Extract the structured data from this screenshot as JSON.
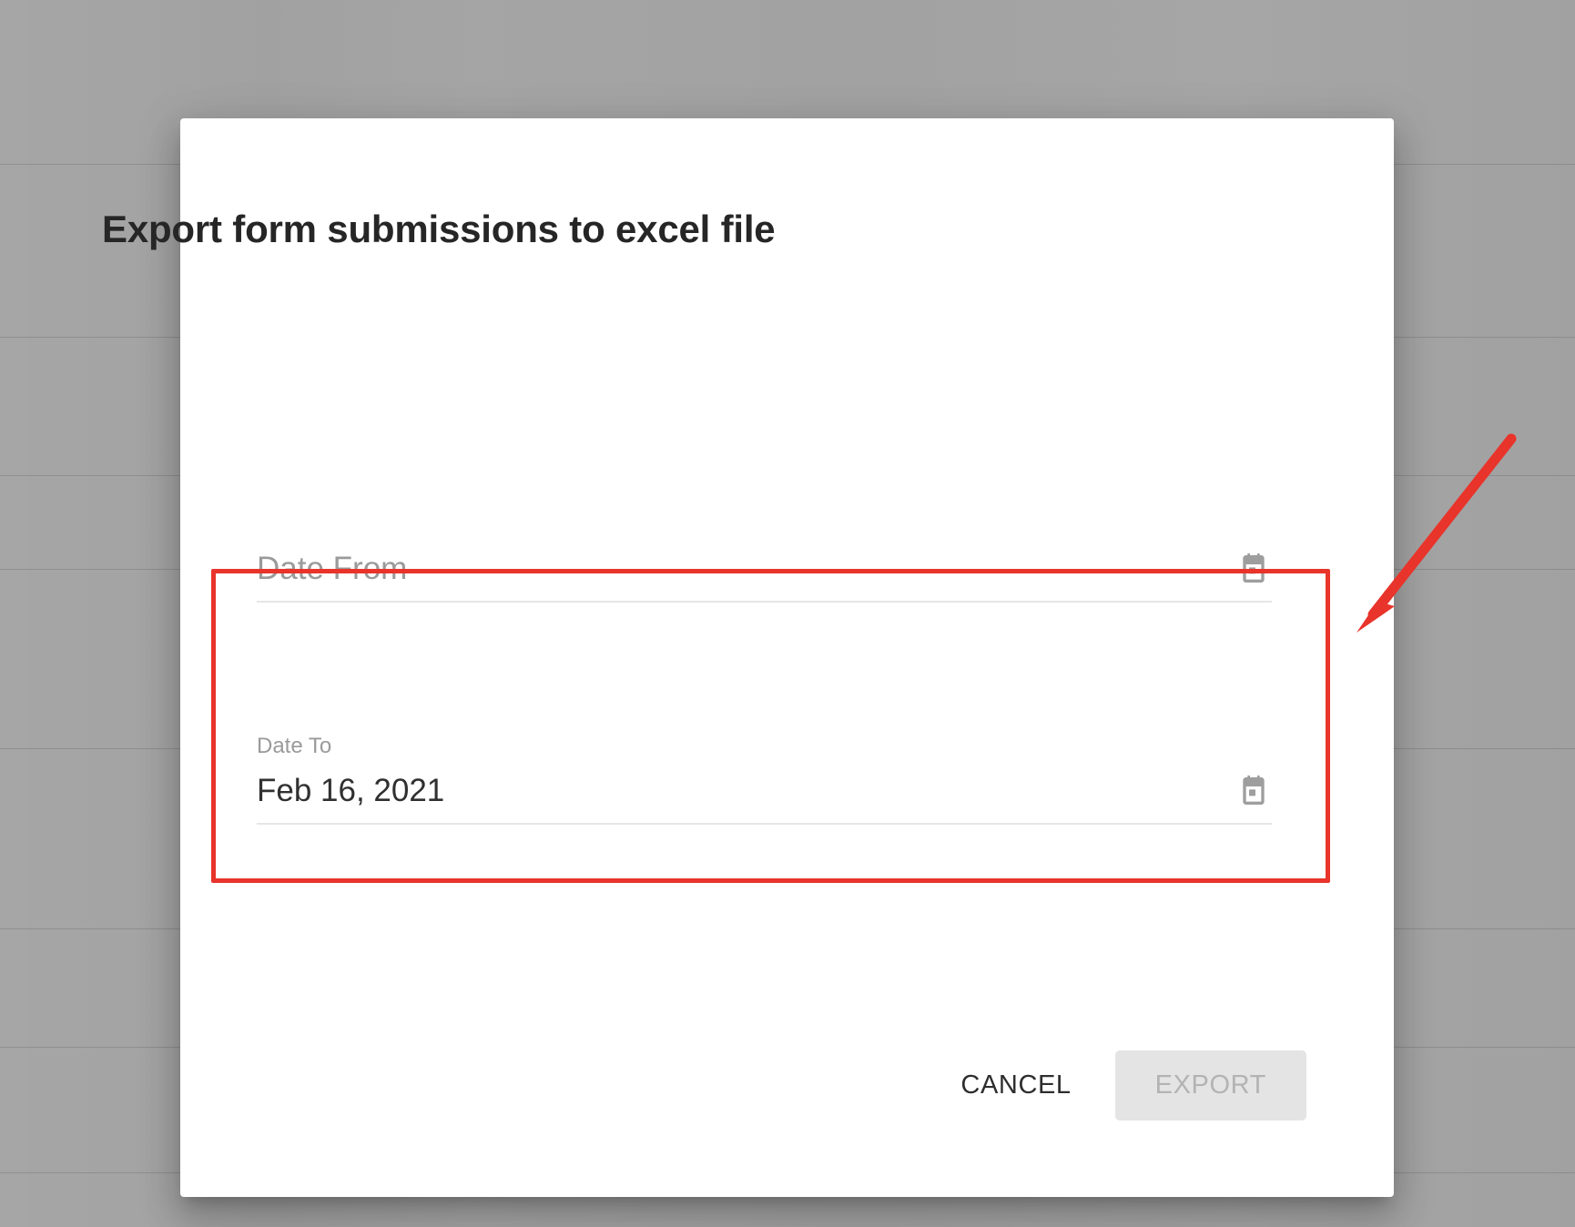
{
  "backdrop": {
    "scrim_color": "#a3a3a3",
    "row_line_color": "#d0d0d0",
    "row_line_positions": [
      180,
      370,
      522,
      625,
      822,
      1020,
      1150,
      1288
    ]
  },
  "dialog": {
    "title": "Export form submissions to excel file",
    "surface_color": "#ffffff",
    "fields": [
      {
        "id": "date-from",
        "label": "Date From",
        "placeholder": "Date From",
        "value": "",
        "label_floated": false,
        "icon": "calendar-icon",
        "icon_color": "#9e9e9e"
      },
      {
        "id": "date-to",
        "label": "Date To",
        "placeholder": "Date To",
        "value": "Feb 16, 2021",
        "label_floated": true,
        "icon": "calendar-icon",
        "icon_color": "#9e9e9e"
      }
    ],
    "actions": {
      "cancel_label": "CANCEL",
      "export_label": "EXPORT",
      "export_disabled": true
    }
  },
  "annotation": {
    "box_color": "#e8342a",
    "arrow_color": "#e8342a",
    "arrow_points_to": "date-fields-region"
  }
}
